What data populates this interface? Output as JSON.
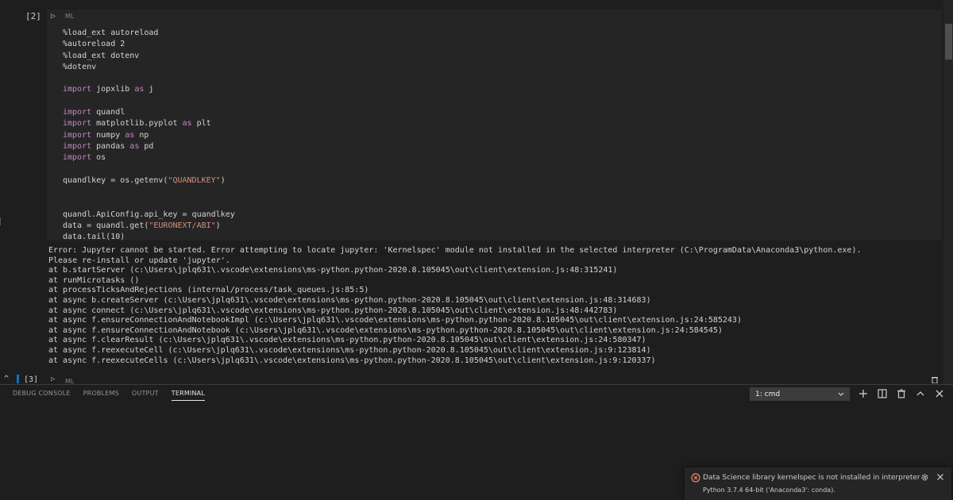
{
  "notebook": {
    "cell2": {
      "count": "[2]",
      "language": "ML",
      "code_lines": [
        [
          {
            "t": "%load_ext autoreload"
          }
        ],
        [
          {
            "t": "%autoreload 2"
          }
        ],
        [
          {
            "t": "%load_ext dotenv"
          }
        ],
        [
          {
            "t": "%dotenv"
          }
        ],
        [],
        [
          {
            "t": "import",
            "c": "kw"
          },
          {
            "t": " jopxlib "
          },
          {
            "t": "as",
            "c": "kw"
          },
          {
            "t": " j"
          }
        ],
        [],
        [
          {
            "t": "import",
            "c": "kw"
          },
          {
            "t": " quandl"
          }
        ],
        [
          {
            "t": "import",
            "c": "kw"
          },
          {
            "t": " matplotlib.pyplot "
          },
          {
            "t": "as",
            "c": "kw"
          },
          {
            "t": " plt"
          }
        ],
        [
          {
            "t": "import",
            "c": "kw"
          },
          {
            "t": " numpy "
          },
          {
            "t": "as",
            "c": "kw"
          },
          {
            "t": " np"
          }
        ],
        [
          {
            "t": "import",
            "c": "kw"
          },
          {
            "t": " pandas "
          },
          {
            "t": "as",
            "c": "kw"
          },
          {
            "t": " pd"
          }
        ],
        [
          {
            "t": "import",
            "c": "kw"
          },
          {
            "t": " os"
          }
        ],
        [],
        [
          {
            "t": "quandlkey = os.getenv("
          },
          {
            "t": "\"QUANDLKEY\"",
            "c": "str"
          },
          {
            "t": ")"
          }
        ],
        [],
        [],
        [
          {
            "t": "quandl.ApiConfig.api_key = quandlkey"
          }
        ],
        [
          {
            "t": "data = quandl.get("
          },
          {
            "t": "\"EURONEXT/ABI\"",
            "c": "str"
          },
          {
            "t": ")"
          }
        ],
        [
          {
            "t": "data.tail(10)"
          }
        ]
      ],
      "output_lines": [
        "Error: Jupyter cannot be started. Error attempting to locate jupyter: 'Kernelspec' module not installed in the selected interpreter (C:\\ProgramData\\Anaconda3\\python.exe).",
        "Please re-install or update 'jupyter'.",
        "at b.startServer (c:\\Users\\jplq631\\.vscode\\extensions\\ms-python.python-2020.8.105045\\out\\client\\extension.js:48:315241)",
        "at runMicrotasks ()",
        "at processTicksAndRejections (internal/process/task_queues.js:85:5)",
        "at async b.createServer (c:\\Users\\jplq631\\.vscode\\extensions\\ms-python.python-2020.8.105045\\out\\client\\extension.js:48:314683)",
        "at async connect (c:\\Users\\jplq631\\.vscode\\extensions\\ms-python.python-2020.8.105045\\out\\client\\extension.js:48:442783)",
        "at async f.ensureConnectionAndNotebookImpl (c:\\Users\\jplq631\\.vscode\\extensions\\ms-python.python-2020.8.105045\\out\\client\\extension.js:24:585243)",
        "at async f.ensureConnectionAndNotebook (c:\\Users\\jplq631\\.vscode\\extensions\\ms-python.python-2020.8.105045\\out\\client\\extension.js:24:584545)",
        "at async f.clearResult (c:\\Users\\jplq631\\.vscode\\extensions\\ms-python.python-2020.8.105045\\out\\client\\extension.js:24:580347)",
        "at async f.reexecuteCell (c:\\Users\\jplq631\\.vscode\\extensions\\ms-python.python-2020.8.105045\\out\\client\\extension.js:9:123814)",
        "at async f.reexecuteCells (c:\\Users\\jplq631\\.vscode\\extensions\\ms-python.python-2020.8.105045\\out\\client\\extension.js:9:120337)"
      ]
    },
    "cell3": {
      "count": "[3]",
      "language": "ML"
    }
  },
  "panel": {
    "tabs": [
      {
        "label": "DEBUG CONSOLE",
        "active": false
      },
      {
        "label": "PROBLEMS",
        "active": false
      },
      {
        "label": "OUTPUT",
        "active": false
      },
      {
        "label": "TERMINAL",
        "active": true
      }
    ],
    "terminal_select": "1: cmd"
  },
  "toast": {
    "message": "Data Science library kernelspec is not installed in interpreter",
    "detail": "Python 3.7.4 64-bit ('Anaconda3': conda).",
    "error_color": "#f48771"
  },
  "icons": {
    "run": "play-icon",
    "terminal_add": "plus-icon",
    "split": "split-icon",
    "kill": "trash-icon",
    "maximize": "chevron-up-icon",
    "close": "close-icon",
    "error": "error-icon",
    "settings": "gear-icon"
  }
}
